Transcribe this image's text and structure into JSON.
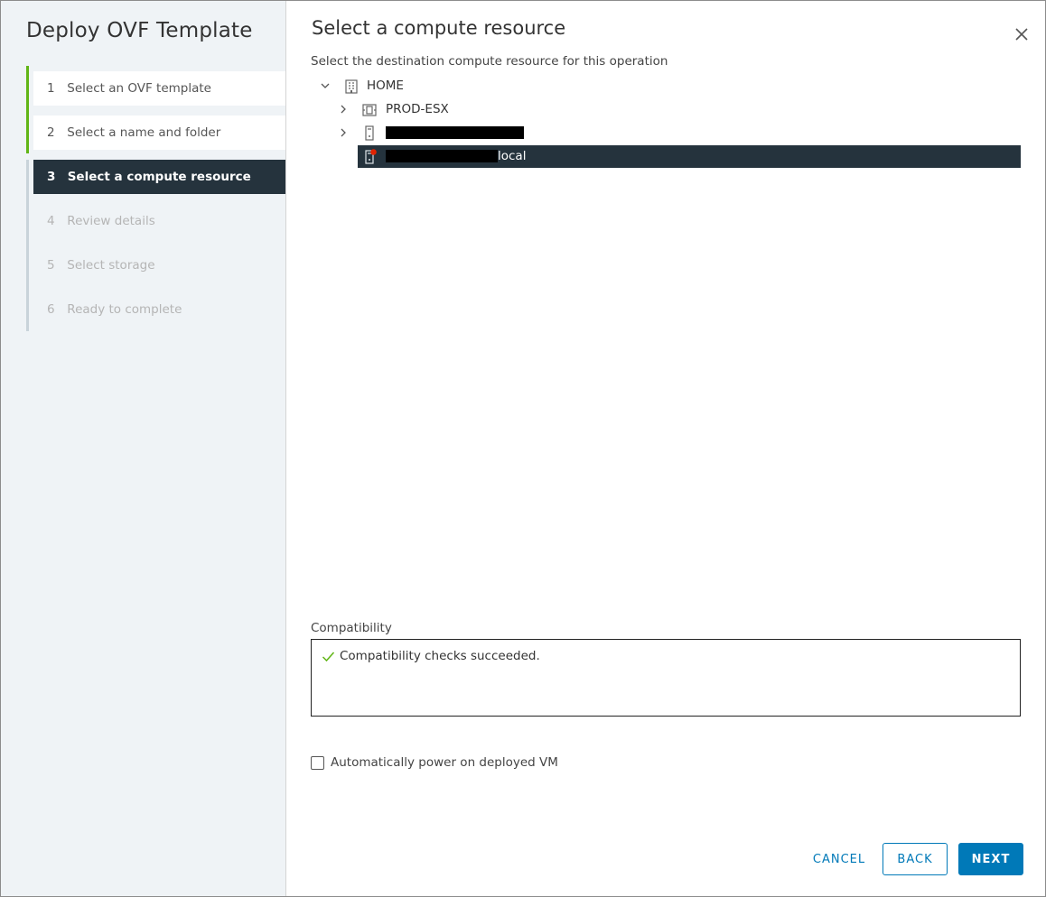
{
  "wizard": {
    "title": "Deploy OVF Template",
    "steps": [
      {
        "number": "1",
        "label": "Select an OVF template",
        "state": "done"
      },
      {
        "number": "2",
        "label": "Select a name and folder",
        "state": "done"
      },
      {
        "number": "3",
        "label": "Select a compute resource",
        "state": "current"
      },
      {
        "number": "4",
        "label": "Review details",
        "state": "future"
      },
      {
        "number": "5",
        "label": "Select storage",
        "state": "future"
      },
      {
        "number": "6",
        "label": "Ready to complete",
        "state": "future"
      }
    ]
  },
  "page": {
    "title": "Select a compute resource",
    "subtitle": "Select the destination compute resource for this operation"
  },
  "tree": {
    "root": {
      "label": "HOME",
      "icon": "datacenter-icon",
      "expanded": true
    },
    "children": [
      {
        "label": "PROD-ESX",
        "icon": "cluster-icon",
        "expanded": false
      },
      {
        "label": "",
        "icon": "host-icon",
        "expanded": false,
        "redacted": true
      },
      {
        "label": "local",
        "icon": "host-warning-icon",
        "selected": true,
        "redacted_prefix": true
      }
    ]
  },
  "compatibility": {
    "label": "Compatibility",
    "message": "Compatibility checks succeeded.",
    "status_icon": "checkmark-icon",
    "status_color": "#60b515"
  },
  "options": {
    "power_on_label": "Automatically power on deployed VM",
    "power_on_checked": false
  },
  "footer": {
    "cancel_label": "CANCEL",
    "back_label": "BACK",
    "next_label": "NEXT"
  },
  "colors": {
    "accent": "#0079b8",
    "selected_bg": "#25333d",
    "progress": "#60b515",
    "warning_badge": "#e12200"
  }
}
